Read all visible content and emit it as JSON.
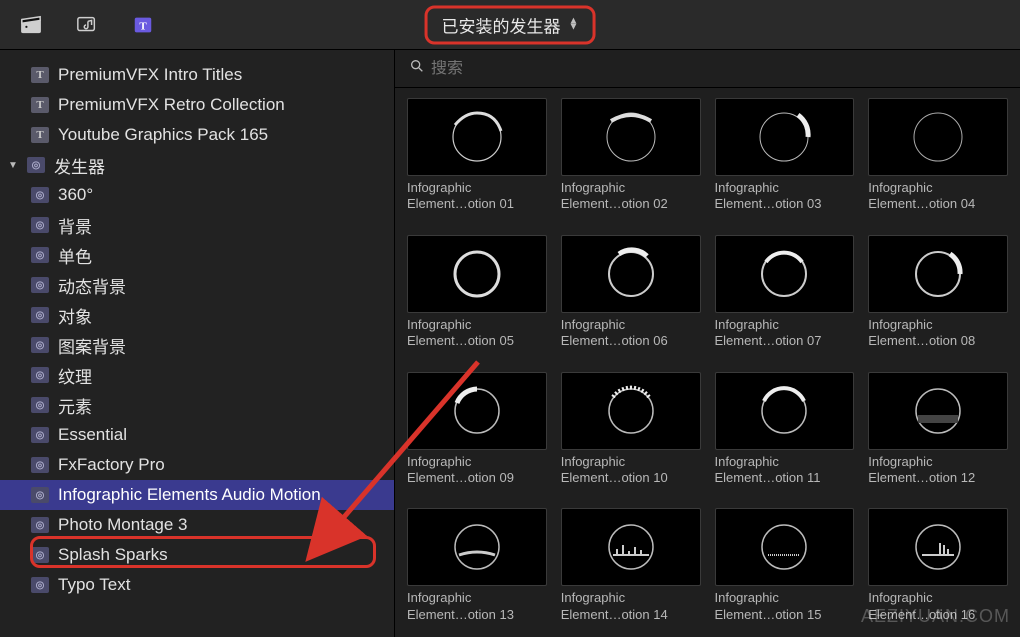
{
  "header": {
    "dropdown_label": "已安装的发生器"
  },
  "search": {
    "placeholder": "搜索"
  },
  "sidebar": {
    "rows": [
      {
        "label": "PremiumVFX Intro Titles",
        "indent": 1,
        "icon": "T",
        "disclosure": ""
      },
      {
        "label": "PremiumVFX Retro Collection",
        "indent": 1,
        "icon": "T",
        "disclosure": ""
      },
      {
        "label": "Youtube Graphics Pack 165",
        "indent": 1,
        "icon": "T",
        "disclosure": ""
      },
      {
        "label": "发生器",
        "indent": 0,
        "icon": "G",
        "disclosure": "▼"
      },
      {
        "label": "360°",
        "indent": 2,
        "icon": "G",
        "disclosure": ""
      },
      {
        "label": "背景",
        "indent": 2,
        "icon": "G",
        "disclosure": ""
      },
      {
        "label": "单色",
        "indent": 2,
        "icon": "G",
        "disclosure": ""
      },
      {
        "label": "动态背景",
        "indent": 2,
        "icon": "G",
        "disclosure": ""
      },
      {
        "label": "对象",
        "indent": 2,
        "icon": "G",
        "disclosure": ""
      },
      {
        "label": "图案背景",
        "indent": 2,
        "icon": "G",
        "disclosure": ""
      },
      {
        "label": "纹理",
        "indent": 2,
        "icon": "G",
        "disclosure": ""
      },
      {
        "label": "元素",
        "indent": 2,
        "icon": "G",
        "disclosure": ""
      },
      {
        "label": "Essential",
        "indent": 2,
        "icon": "G",
        "disclosure": ""
      },
      {
        "label": "FxFactory Pro",
        "indent": 2,
        "icon": "G",
        "disclosure": ""
      },
      {
        "label": "Infographic Elements Audio Motion",
        "indent": 2,
        "icon": "G",
        "disclosure": "",
        "selected": true
      },
      {
        "label": "Photo Montage 3",
        "indent": 2,
        "icon": "G",
        "disclosure": ""
      },
      {
        "label": "Splash Sparks",
        "indent": 2,
        "icon": "G",
        "disclosure": ""
      },
      {
        "label": "Typo Text",
        "indent": 2,
        "icon": "G",
        "disclosure": ""
      }
    ]
  },
  "grid": {
    "items": [
      {
        "line1": "Infographic",
        "line2": "Element…otion 01"
      },
      {
        "line1": "Infographic",
        "line2": "Element…otion 02"
      },
      {
        "line1": "Infographic",
        "line2": "Element…otion 03"
      },
      {
        "line1": "Infographic",
        "line2": "Element…otion 04"
      },
      {
        "line1": "Infographic",
        "line2": "Element…otion 05"
      },
      {
        "line1": "Infographic",
        "line2": "Element…otion 06"
      },
      {
        "line1": "Infographic",
        "line2": "Element…otion 07"
      },
      {
        "line1": "Infographic",
        "line2": "Element…otion 08"
      },
      {
        "line1": "Infographic",
        "line2": "Element…otion 09"
      },
      {
        "line1": "Infographic",
        "line2": "Element…otion 10"
      },
      {
        "line1": "Infographic",
        "line2": "Element…otion 11"
      },
      {
        "line1": "Infographic",
        "line2": "Element…otion 12"
      },
      {
        "line1": "Infographic",
        "line2": "Element…otion 13"
      },
      {
        "line1": "Infographic",
        "line2": "Element…otion 14"
      },
      {
        "line1": "Infographic",
        "line2": "Element…otion 15"
      },
      {
        "line1": "Infographic",
        "line2": "Element…otion 16"
      }
    ]
  },
  "watermark": "AEZIYUAN.COM"
}
